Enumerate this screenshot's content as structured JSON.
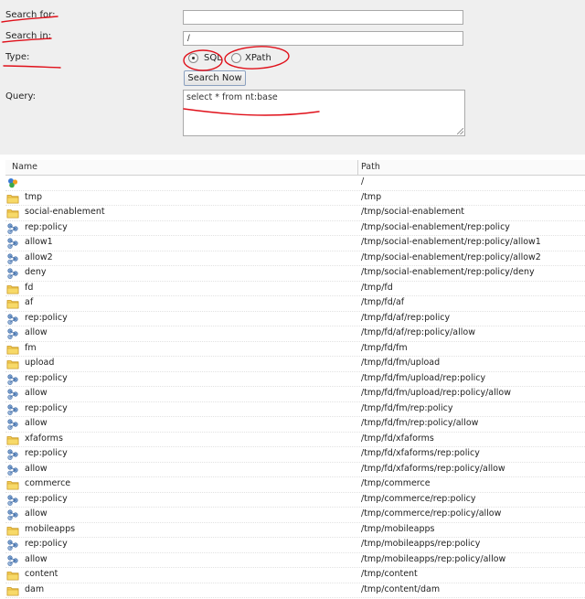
{
  "form": {
    "search_for_label": "Search for:",
    "search_for_value": "",
    "search_in_label": "Search in:",
    "search_in_value": "/",
    "type_label": "Type:",
    "type_options": [
      "SQL",
      "XPath"
    ],
    "type_selected": "SQL",
    "search_button": "Search Now",
    "query_label": "Query:",
    "query_value": "select * from nt:base"
  },
  "table": {
    "headers": {
      "name": "Name",
      "path": "Path"
    },
    "rows": [
      {
        "name": "",
        "path": "/",
        "icon": "repository-root-icon"
      },
      {
        "name": "tmp",
        "path": "/tmp",
        "icon": "folder-icon"
      },
      {
        "name": "social-enablement",
        "path": "/tmp/social-enablement",
        "icon": "folder-icon"
      },
      {
        "name": "rep:policy",
        "path": "/tmp/social-enablement/rep:policy",
        "icon": "node-icon"
      },
      {
        "name": "allow1",
        "path": "/tmp/social-enablement/rep:policy/allow1",
        "icon": "node-icon"
      },
      {
        "name": "allow2",
        "path": "/tmp/social-enablement/rep:policy/allow2",
        "icon": "node-icon"
      },
      {
        "name": "deny",
        "path": "/tmp/social-enablement/rep:policy/deny",
        "icon": "node-icon"
      },
      {
        "name": "fd",
        "path": "/tmp/fd",
        "icon": "folder-icon"
      },
      {
        "name": "af",
        "path": "/tmp/fd/af",
        "icon": "folder-icon"
      },
      {
        "name": "rep:policy",
        "path": "/tmp/fd/af/rep:policy",
        "icon": "node-icon"
      },
      {
        "name": "allow",
        "path": "/tmp/fd/af/rep:policy/allow",
        "icon": "node-icon"
      },
      {
        "name": "fm",
        "path": "/tmp/fd/fm",
        "icon": "folder-icon"
      },
      {
        "name": "upload",
        "path": "/tmp/fd/fm/upload",
        "icon": "folder-icon"
      },
      {
        "name": "rep:policy",
        "path": "/tmp/fd/fm/upload/rep:policy",
        "icon": "node-icon"
      },
      {
        "name": "allow",
        "path": "/tmp/fd/fm/upload/rep:policy/allow",
        "icon": "node-icon"
      },
      {
        "name": "rep:policy",
        "path": "/tmp/fd/fm/rep:policy",
        "icon": "node-icon"
      },
      {
        "name": "allow",
        "path": "/tmp/fd/fm/rep:policy/allow",
        "icon": "node-icon"
      },
      {
        "name": "xfaforms",
        "path": "/tmp/fd/xfaforms",
        "icon": "folder-icon"
      },
      {
        "name": "rep:policy",
        "path": "/tmp/fd/xfaforms/rep:policy",
        "icon": "node-icon"
      },
      {
        "name": "allow",
        "path": "/tmp/fd/xfaforms/rep:policy/allow",
        "icon": "node-icon"
      },
      {
        "name": "commerce",
        "path": "/tmp/commerce",
        "icon": "folder-icon"
      },
      {
        "name": "rep:policy",
        "path": "/tmp/commerce/rep:policy",
        "icon": "node-icon"
      },
      {
        "name": "allow",
        "path": "/tmp/commerce/rep:policy/allow",
        "icon": "node-icon"
      },
      {
        "name": "mobileapps",
        "path": "/tmp/mobileapps",
        "icon": "folder-icon"
      },
      {
        "name": "rep:policy",
        "path": "/tmp/mobileapps/rep:policy",
        "icon": "node-icon"
      },
      {
        "name": "allow",
        "path": "/tmp/mobileapps/rep:policy/allow",
        "icon": "node-icon"
      },
      {
        "name": "content",
        "path": "/tmp/content",
        "icon": "folder-icon"
      },
      {
        "name": "dam",
        "path": "/tmp/content/dam",
        "icon": "folder-icon"
      }
    ]
  },
  "colors": {
    "annotation": "#e0101a",
    "panel_bg": "#efefef",
    "folder": "#e8b93a"
  }
}
